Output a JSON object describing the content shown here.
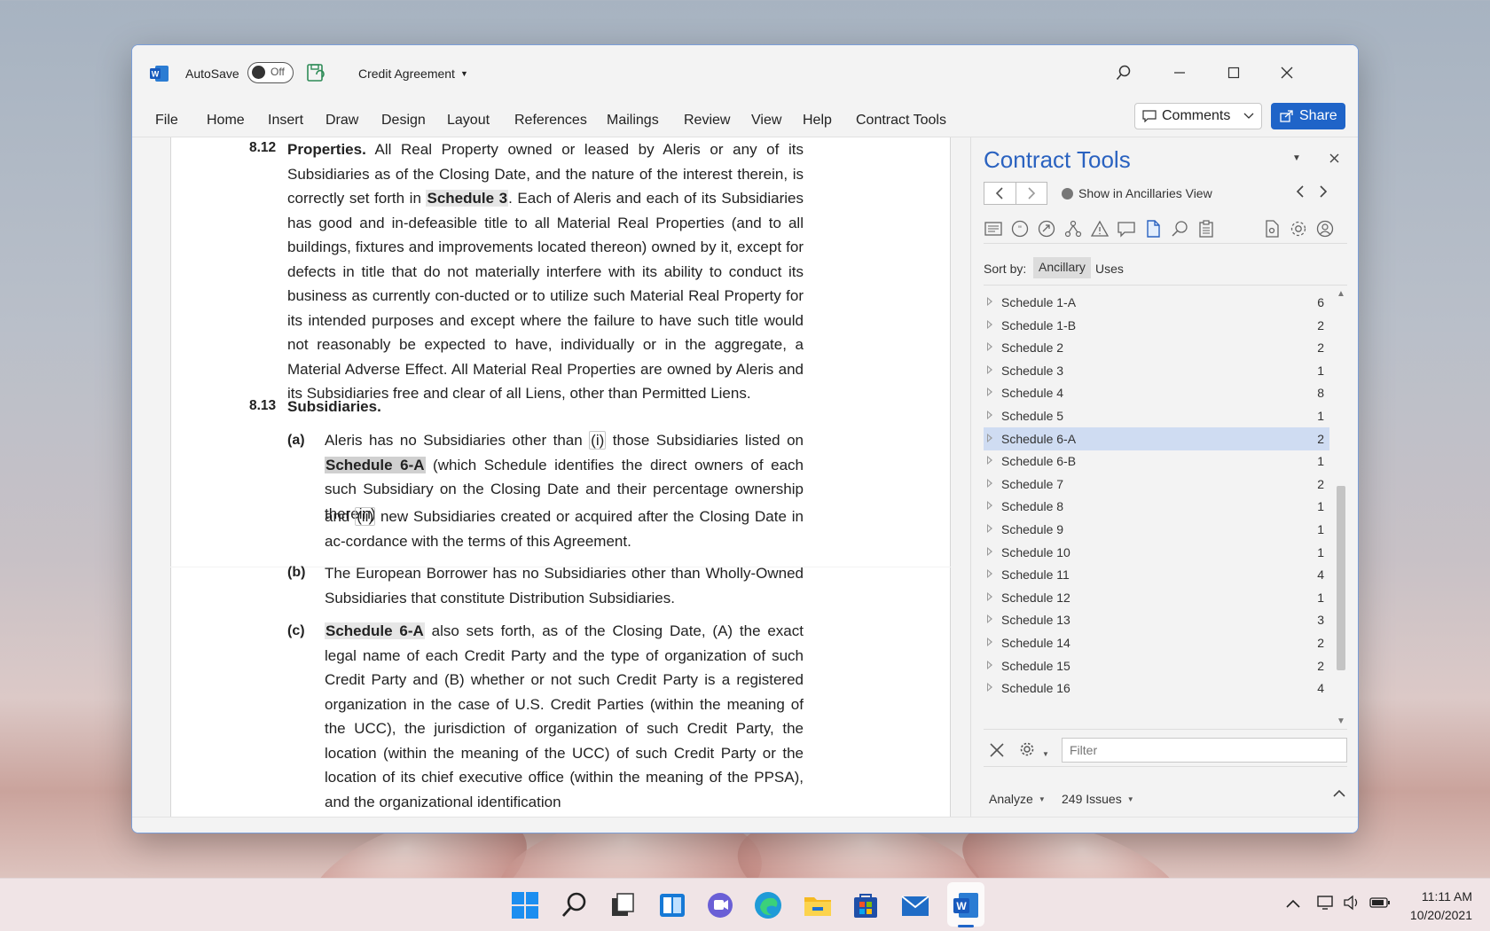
{
  "titlebar": {
    "autosave_label": "AutoSave",
    "autosave_state": "Off",
    "document_title": "Credit Agreement"
  },
  "menu": {
    "items": [
      "File",
      "Home",
      "Insert",
      "Draw",
      "Design",
      "Layout",
      "References",
      "Mailings",
      "Review",
      "View",
      "Help",
      "Contract Tools"
    ],
    "comments_label": "Comments",
    "share_label": "Share"
  },
  "document": {
    "s812": {
      "number": "8.12",
      "heading": "Properties.",
      "text_a": " All Real Property owned or leased by Aleris or any of its Subsidiaries as of the Closing Date, and the nature of the interest therein, is correctly set forth in ",
      "ref": "Schedule 3",
      "text_b": ". Each of Aleris and each of its Subsidiaries has good and in-defeasible title to all Material Real Properties (and to all buildings, fixtures and improvements located thereon) owned by it, except for defects in title that do not materially interfere with its ability to conduct its business as currently con-ducted or to utilize such Material Real Property for its intended purposes and except where the failure to have such title would not reasonably be expected to have, individually or in the aggregate, a Material Adverse Effect. All Material Real Properties are owned by Aleris and its Subsidiaries free and clear of all Liens, other than Permitted Liens."
    },
    "s813": {
      "number": "8.13",
      "heading": "Subsidiaries.",
      "a_label": "(a)",
      "a_text1": "Aleris has no Subsidiaries other than ",
      "a_i": "(i)",
      "a_text2": " those Subsidiaries listed on ",
      "a_ref": "Schedule 6-A",
      "a_text3": " (which Schedule identifies the direct owners of each such Subsidiary on the Closing Date and their percentage ownership therein)",
      "a_cont1": "and ",
      "a_ii": "(ii)",
      "a_cont2": " new Subsidiaries created or acquired after the Closing Date in ac-cordance with the terms of this Agreement.",
      "b_label": "(b)",
      "b_text": "The European Borrower has no Subsidiaries other than Wholly-Owned Subsidiaries that constitute Distribution Subsidiaries.",
      "c_label": "(c)",
      "c_ref": "Schedule 6-A",
      "c_text": " also sets forth, as of the Closing Date, (A) the exact legal name of each Credit Party and the type of organization of such Credit Party and (B) whether or not such Credit Party is a registered organization in the case of U.S. Credit Parties (within the meaning of the UCC), the jurisdiction of organization of such Credit Party, the location (within the meaning of the UCC) of such Credit Party or the location of its chief executive office (within the meaning of the PPSA), and the organizational identification"
    }
  },
  "pane": {
    "title": "Contract Tools",
    "ancillaries_view": "Show in Ancillaries View",
    "sort_by": "Sort by:",
    "sort_ancillary": "Ancillary",
    "sort_uses": "Uses",
    "schedules": [
      {
        "name": "Schedule 1-A",
        "count": "6"
      },
      {
        "name": "Schedule 1-B",
        "count": "2"
      },
      {
        "name": "Schedule 2",
        "count": "2"
      },
      {
        "name": "Schedule 3",
        "count": "1"
      },
      {
        "name": "Schedule 4",
        "count": "8"
      },
      {
        "name": "Schedule 5",
        "count": "1"
      },
      {
        "name": "Schedule 6-A",
        "count": "2"
      },
      {
        "name": "Schedule 6-B",
        "count": "1"
      },
      {
        "name": "Schedule 7",
        "count": "2"
      },
      {
        "name": "Schedule 8",
        "count": "1"
      },
      {
        "name": "Schedule 9",
        "count": "1"
      },
      {
        "name": "Schedule 10",
        "count": "1"
      },
      {
        "name": "Schedule 11",
        "count": "4"
      },
      {
        "name": "Schedule 12",
        "count": "1"
      },
      {
        "name": "Schedule 13",
        "count": "3"
      },
      {
        "name": "Schedule 14",
        "count": "2"
      },
      {
        "name": "Schedule 15",
        "count": "2"
      },
      {
        "name": "Schedule 16",
        "count": "4"
      }
    ],
    "selected_schedule": "Schedule 6-A",
    "filter_placeholder": "Filter",
    "analyze_label": "Analyze",
    "issues_label": "249 Issues"
  },
  "taskbar": {
    "time": "11:11 AM",
    "date": "10/20/2021"
  },
  "colors": {
    "accent": "#1f64c8",
    "pane_title": "#2a62c0",
    "selection": "#cfdcf2"
  }
}
